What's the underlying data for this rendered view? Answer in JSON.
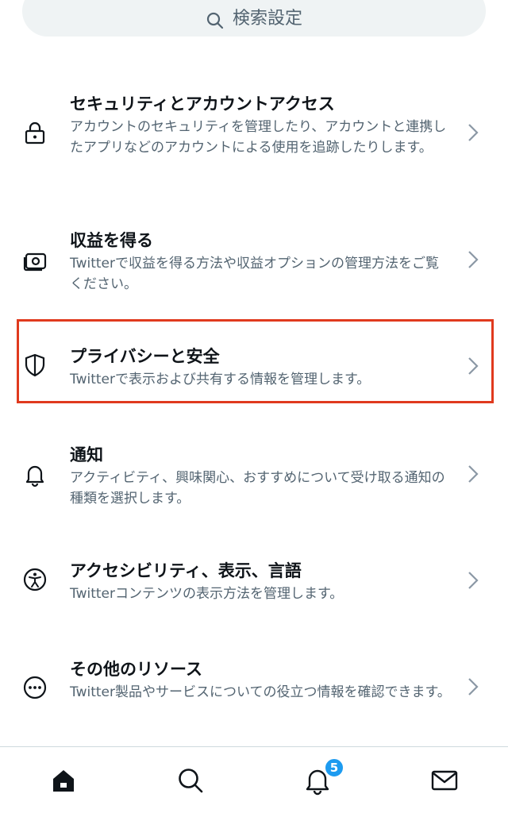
{
  "search": {
    "label": "検索設定"
  },
  "settings": {
    "items": [
      {
        "title": "セキュリティとアカウントアクセス",
        "desc": "アカウントのセキュリティを管理したり、アカウントと連携したアプリなどのアカウントによる使用を追跡したりします。"
      },
      {
        "title": "収益を得る",
        "desc": "Twitterで収益を得る方法や収益オプションの管理方法をご覧ください。"
      },
      {
        "title": "プライバシーと安全",
        "desc": "Twitterで表示および共有する情報を管理します。"
      },
      {
        "title": "通知",
        "desc": "アクティビティ、興味関心、おすすめについて受け取る通知の種類を選択します。"
      },
      {
        "title": "アクセシビリティ、表示、言語",
        "desc": "Twitterコンテンツの表示方法を管理します。"
      },
      {
        "title": "その他のリソース",
        "desc": "Twitter製品やサービスについての役立つ情報を確認できます。"
      }
    ]
  },
  "bottom_nav": {
    "notification_badge": "5"
  },
  "colors": {
    "highlight": "#e03a1e",
    "accent": "#1d9bf0",
    "text": "#0f1419",
    "muted": "#536471"
  }
}
